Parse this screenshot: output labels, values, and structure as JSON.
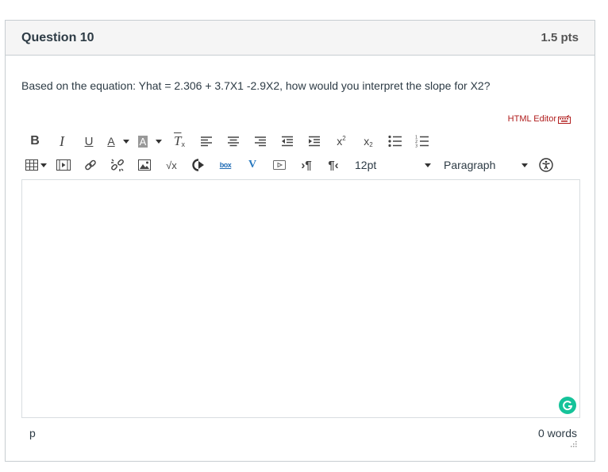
{
  "question": {
    "title": "Question 10",
    "points": "1.5 pts",
    "text": "Based on the equation: Yhat = 2.306 + 3.7X1 -2.9X2, how would you interpret the slope for X2?"
  },
  "editor": {
    "html_editor_label": "HTML Editor",
    "font_size": "12pt",
    "block_format": "Paragraph",
    "content": "",
    "path": "p",
    "word_count": "0 words"
  },
  "colors": {
    "header_bg": "#f5f5f5",
    "border": "#c7cdd1",
    "link_red": "#b01c1c",
    "grammarly_green": "#15c39a",
    "text": "#2d3b45"
  },
  "toolbar_row1_icons": [
    "bold-icon",
    "italic-icon",
    "underline-icon",
    "text-color-icon",
    "background-color-icon",
    "clear-formatting-icon",
    "align-left-icon",
    "align-center-icon",
    "align-right-icon",
    "outdent-icon",
    "indent-icon",
    "superscript-icon",
    "subscript-icon",
    "bullet-list-icon",
    "numbered-list-icon"
  ],
  "toolbar_row2_icons": [
    "table-icon",
    "media-icon",
    "link-icon",
    "unlink-icon",
    "image-icon",
    "math-icon",
    "lti-tool-icon",
    "box-icon",
    "vimeo-icon",
    "video-icon",
    "ltr-icon",
    "rtl-icon",
    "accessibility-icon"
  ]
}
